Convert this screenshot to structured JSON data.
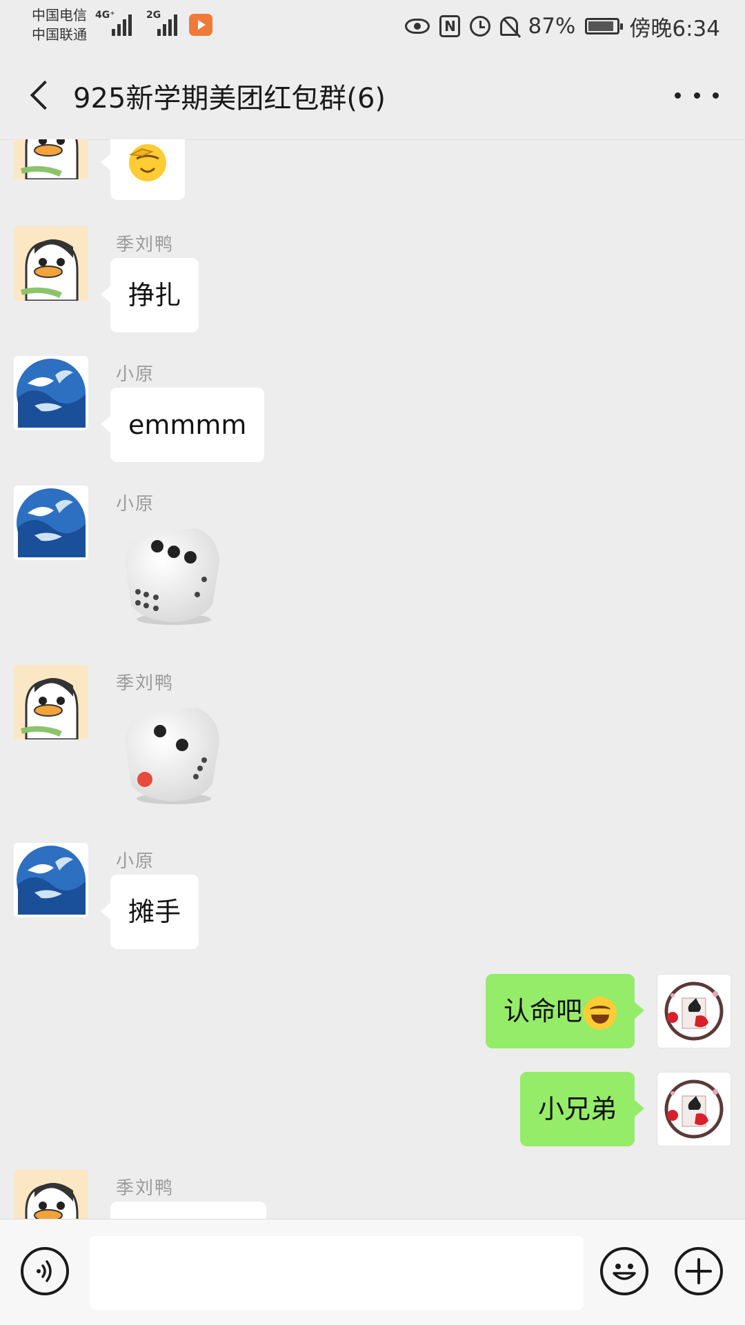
{
  "status_bar": {
    "carrier_1": "中国电信",
    "carrier_2": "中国联通",
    "network_1": "4G⁺",
    "network_2": "2G",
    "battery": "87%",
    "time": "傍晚6:34"
  },
  "header": {
    "title": "925新学期美团红包群(6)"
  },
  "messages": [
    {
      "side": "left",
      "sender": "",
      "avatar": "penguin",
      "type": "emoji",
      "content": "facepalm"
    },
    {
      "side": "left",
      "sender": "季刘鸭",
      "avatar": "penguin",
      "type": "text",
      "content": "挣扎"
    },
    {
      "side": "left",
      "sender": "小原",
      "avatar": "bird",
      "type": "text",
      "content": "emmmm"
    },
    {
      "side": "left",
      "sender": "小原",
      "avatar": "bird",
      "type": "dice",
      "dice_value": 3
    },
    {
      "side": "left",
      "sender": "季刘鸭",
      "avatar": "penguin",
      "type": "dice",
      "dice_value": 2
    },
    {
      "side": "left",
      "sender": "小原",
      "avatar": "bird",
      "type": "text",
      "content": "摊手"
    },
    {
      "side": "right",
      "sender": "",
      "avatar": "me",
      "type": "text",
      "content": "认命吧",
      "trailing_emoji": "tears-of-joy"
    },
    {
      "side": "right",
      "sender": "",
      "avatar": "me",
      "type": "text",
      "content": "小兄弟"
    },
    {
      "side": "left",
      "sender": "季刘鸭",
      "avatar": "penguin",
      "type": "text",
      "content": ""
    }
  ],
  "input_bar": {
    "text": ""
  },
  "colors": {
    "background": "#ededed",
    "own_bubble": "#95ec69",
    "other_bubble": "#ffffff",
    "sender_name": "#9a9a9a"
  }
}
